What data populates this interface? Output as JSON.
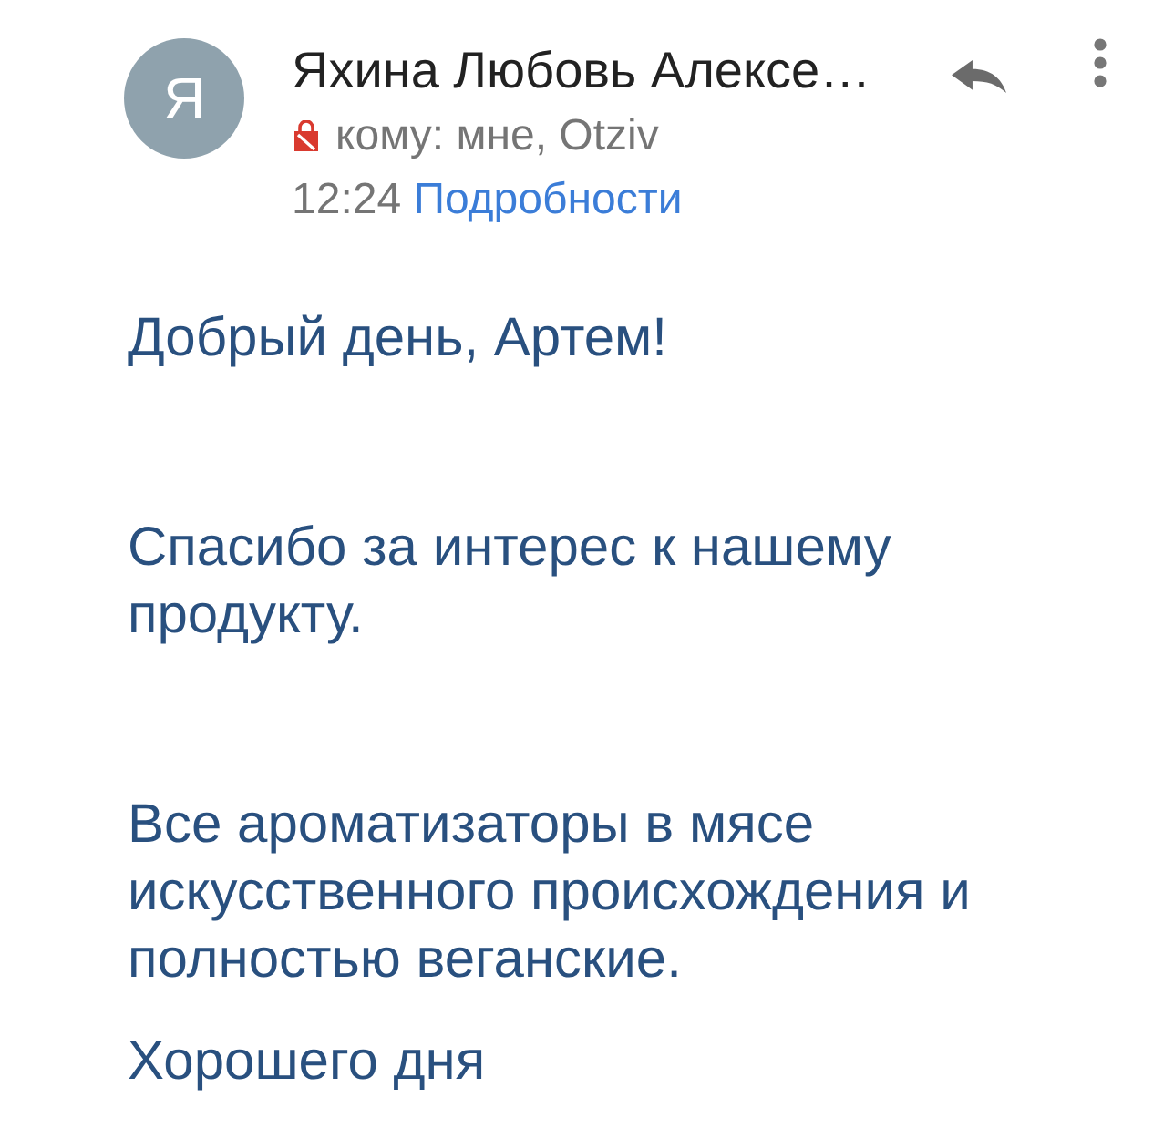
{
  "header": {
    "avatar_letter": "Я",
    "sender": "Яхина Любовь Алексе…",
    "recipients": "кому: мне, Otziv",
    "time": "12:24",
    "details_link": "Подробности"
  },
  "body": {
    "paragraphs": [
      "Добрый день, Артем!",
      "Спасибо за интерес к нашему продукту.",
      "Все ароматизаторы в мясе искусственного происхождения и полностью веганские.",
      "Хорошего дня"
    ]
  }
}
